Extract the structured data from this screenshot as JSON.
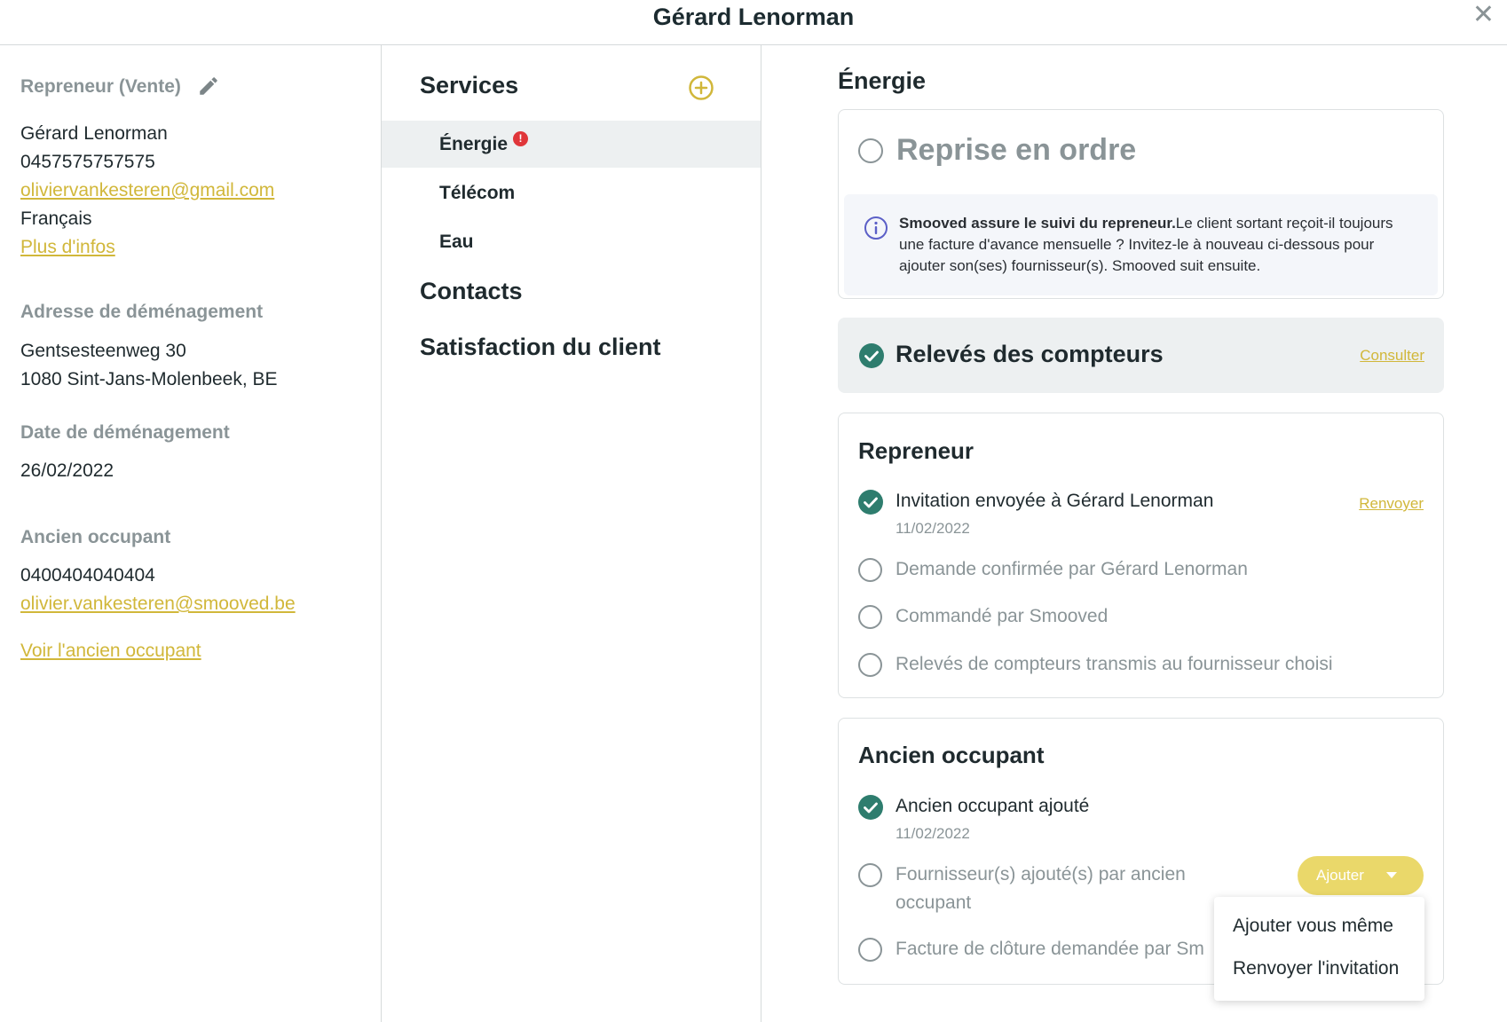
{
  "header": {
    "title": "Gérard Lenorman",
    "close_glyph": "✕"
  },
  "left": {
    "repreneur": {
      "label": "Repreneur (Vente)",
      "name": "Gérard Lenorman",
      "phone": "0457575757575",
      "email": "oliviervankesteren@gmail.com",
      "language": "Français",
      "more_link": "Plus d'infos"
    },
    "address": {
      "label": "Adresse de déménagement",
      "line1": "Gentsesteenweg 30",
      "line2": "1080 Sint-Jans-Molenbeek, BE"
    },
    "move_date": {
      "label": "Date de déménagement",
      "value": "26/02/2022"
    },
    "previous": {
      "label": "Ancien occupant",
      "phone": "0400404040404",
      "email": "olivier.vankesteren@smooved.be",
      "link": "Voir l'ancien occupant"
    }
  },
  "middle": {
    "services_title": "Services",
    "items": [
      {
        "label": "Énergie",
        "alert": "!"
      },
      {
        "label": "Télécom"
      },
      {
        "label": "Eau"
      }
    ],
    "contacts_title": "Contacts",
    "satisfaction_title": "Satisfaction du client"
  },
  "right": {
    "title": "Énergie",
    "reprise": {
      "title": "Reprise en ordre",
      "info_bold": "Smooved assure le suivi du repreneur.",
      "info_text": "Le client sortant reçoit-il toujours une facture d'avance mensuelle ? Invitez-le à nouveau ci-dessous pour ajouter son(ses) fournisseur(s). Smooved suit ensuite."
    },
    "releves": {
      "title": "Relevés des compteurs",
      "link": "Consulter"
    },
    "repreneur": {
      "title": "Repreneur",
      "steps": [
        {
          "label": "Invitation envoyée à Gérard Lenorman",
          "date": "11/02/2022",
          "done": true,
          "link": "Renvoyer"
        },
        {
          "label": "Demande confirmée par Gérard Lenorman",
          "done": false
        },
        {
          "label": "Commandé par Smooved",
          "done": false
        },
        {
          "label": "Relevés de compteurs transmis au fournisseur choisi",
          "done": false
        }
      ]
    },
    "ancien": {
      "title": "Ancien occupant",
      "steps": [
        {
          "label": "Ancien occupant ajouté",
          "date": "11/02/2022",
          "done": true
        },
        {
          "label_line1": "Fournisseur(s) ajouté(s) par ancien",
          "label_line2": "occupant",
          "done": false
        },
        {
          "label": "Facture de clôture demandée par Sm",
          "done": false
        }
      ],
      "button": "Ajouter",
      "dropdown": [
        "Ajouter vous même",
        "Renvoyer l'invitation"
      ]
    }
  },
  "colors": {
    "accent": "#d1b73a",
    "success": "#2e7d6e",
    "alert": "#e0363a",
    "info": "#5b5fc7"
  }
}
